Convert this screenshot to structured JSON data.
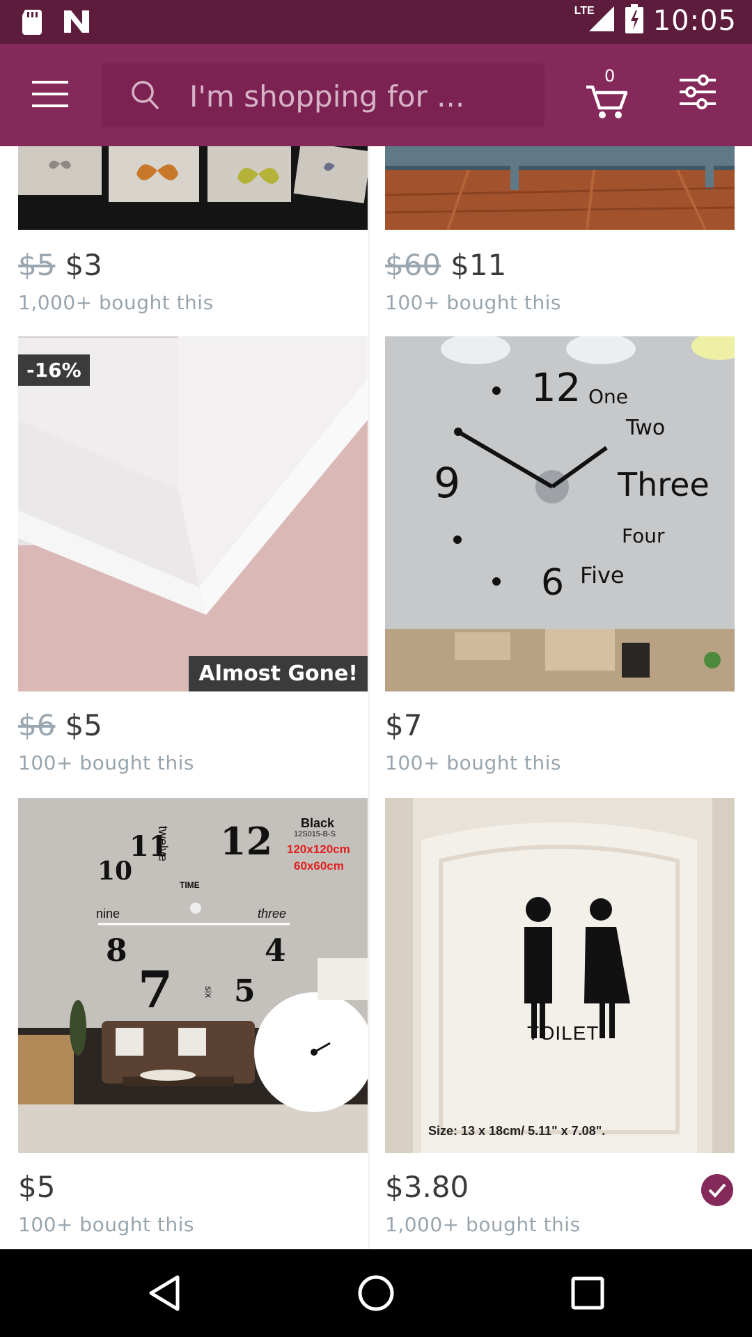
{
  "status_bar": {
    "network": "LTE",
    "time": "10:05"
  },
  "toolbar": {
    "search_placeholder": "I'm shopping for ...",
    "cart_count": "0"
  },
  "products": [
    {
      "old_price": "$5",
      "price": "$3",
      "bought": "1,000+ bought this"
    },
    {
      "old_price": "$60",
      "price": "$11",
      "bought": "100+ bought this"
    },
    {
      "old_price": "$6",
      "price": "$5",
      "bought": "100+ bought this",
      "discount_badge": "-16%",
      "stock_badge": "Almost Gone!"
    },
    {
      "old_price": "",
      "price": "$7",
      "bought": "100+ bought this",
      "image_text": {
        "n12": "12",
        "n9": "9",
        "n6": "6",
        "one": "One",
        "two": "Two",
        "three": "Three",
        "four": "Four",
        "five": "Five"
      }
    },
    {
      "old_price": "",
      "price": "$5",
      "bought": "100+ bought this",
      "image_text": {
        "color": "Black",
        "model": "12S015-B-S",
        "size1": "120x120cm",
        "size2": "60x60cm",
        "n11": "11",
        "n12": "12",
        "n10": "10",
        "twelve": "twelve",
        "time": "TIME",
        "nine": "nine",
        "three": "three",
        "n8": "8",
        "n4": "4",
        "n7": "7",
        "n5": "5",
        "six": "six"
      }
    },
    {
      "old_price": "",
      "price": "$3.80",
      "bought": "1,000+ bought this",
      "image_text": {
        "sign": "TOILET",
        "size": "Size: 13 x 18cm/ 5.11\" x 7.08\"."
      }
    }
  ],
  "colors": {
    "status_bar": "#5e1c3d",
    "toolbar": "#85295a",
    "accent": "#85295a"
  }
}
